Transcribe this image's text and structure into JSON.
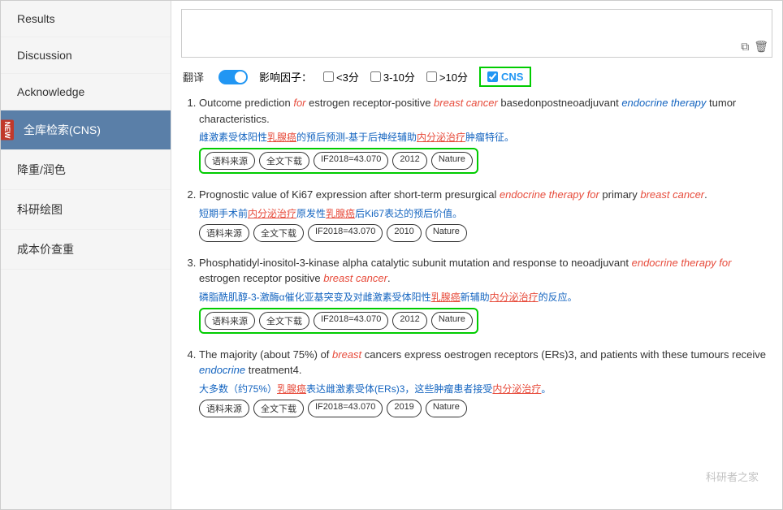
{
  "sidebar": {
    "items": [
      {
        "label": "Results",
        "active": false,
        "hasBadge": false
      },
      {
        "label": "Discussion",
        "active": false,
        "hasBadge": false
      },
      {
        "label": "Acknowledge",
        "active": false,
        "hasBadge": false
      },
      {
        "label": "全库检索(CNS)",
        "active": true,
        "hasBadge": true
      },
      {
        "label": "降重/润色",
        "active": false,
        "hasBadge": false
      },
      {
        "label": "科研绘图",
        "active": false,
        "hasBadge": false
      },
      {
        "label": "成本价查重",
        "active": false,
        "hasBadge": false
      }
    ]
  },
  "filter": {
    "translate_label": "翻译",
    "impact_label": "影响因子：",
    "opt1": "<3分",
    "opt2": "3-10分",
    "opt3": ">10分",
    "cns_label": "CNS"
  },
  "results": [
    {
      "num": 1,
      "title_parts": [
        {
          "text": "Outcome prediction ",
          "style": "normal"
        },
        {
          "text": "for",
          "style": "italic-red"
        },
        {
          "text": " estrogen receptor-positive ",
          "style": "normal"
        },
        {
          "text": "breast cancer",
          "style": "italic-red"
        },
        {
          "text": " basedonpostneoadjuvant ",
          "style": "normal"
        },
        {
          "text": "endocrine therapy",
          "style": "blue-link"
        },
        {
          "text": " tumor characteristics.",
          "style": "normal"
        }
      ],
      "subtitle": "雌激素受体阳性乳腺癌的预后预测-基于后神经辅助内分泌治疗肿瘤特征。",
      "subtitle_underlines": [
        {
          "text": "乳腺癌",
          "style": "red-underline"
        },
        {
          "text": "内分泌治疗",
          "style": "red-underline"
        }
      ],
      "tags": [
        "语料来源",
        "全文下载",
        "IF2018=43.070",
        "2012",
        "Nature"
      ],
      "tags_boxed": true
    },
    {
      "num": 2,
      "title_parts": [
        {
          "text": "Prognostic value of Ki67 expression after short-term presurgical ",
          "style": "normal"
        },
        {
          "text": "endocrine therapy for",
          "style": "italic-red"
        },
        {
          "text": " primary ",
          "style": "normal"
        },
        {
          "text": "breast cancer",
          "style": "italic-red"
        },
        {
          "text": ".",
          "style": "normal"
        }
      ],
      "subtitle": "短期手术前内分泌治疗原发性乳腺癌后Ki67表达的预后价值。",
      "tags": [
        "语料来源",
        "全文下载",
        "IF2018=43.070",
        "2010",
        "Nature"
      ],
      "tags_boxed": false
    },
    {
      "num": 3,
      "title_parts": [
        {
          "text": "Phosphatidyl-inositol-3-kinase alpha catalytic subunit mutation and response to neoadjuvant ",
          "style": "normal"
        },
        {
          "text": "endocrine therapy for",
          "style": "italic-red"
        },
        {
          "text": " estrogen receptor positive ",
          "style": "normal"
        },
        {
          "text": "breast cancer",
          "style": "italic-red"
        },
        {
          "text": ".",
          "style": "normal"
        }
      ],
      "subtitle": "磷脂酰肌醇-3-激酶α催化亚基突变及对雌激素受体阳性乳腺癌新辅助内分泌治疗的反应。",
      "tags": [
        "语料来源",
        "全文下载",
        "IF2018=43.070",
        "2012",
        "Nature"
      ],
      "tags_boxed": true
    },
    {
      "num": 4,
      "title_parts": [
        {
          "text": "The majority (about 75%) of ",
          "style": "normal"
        },
        {
          "text": "breast",
          "style": "italic-red"
        },
        {
          "text": " cancers express oestrogen receptors (ERs)3, and patients with these tumours receive ",
          "style": "normal"
        },
        {
          "text": "endocrine",
          "style": "blue-link"
        },
        {
          "text": " treatment4.",
          "style": "normal"
        }
      ],
      "subtitle": "大多数（约75%）乳腺癌表达雌激素受体(ERs)3，这些肿瘤患者接受内分泌治疗。",
      "tags": [
        "语料来源",
        "全文下载",
        "IF2018=43.070",
        "2019",
        "Nature"
      ],
      "tags_boxed": false
    }
  ],
  "watermark": "科研者之家"
}
